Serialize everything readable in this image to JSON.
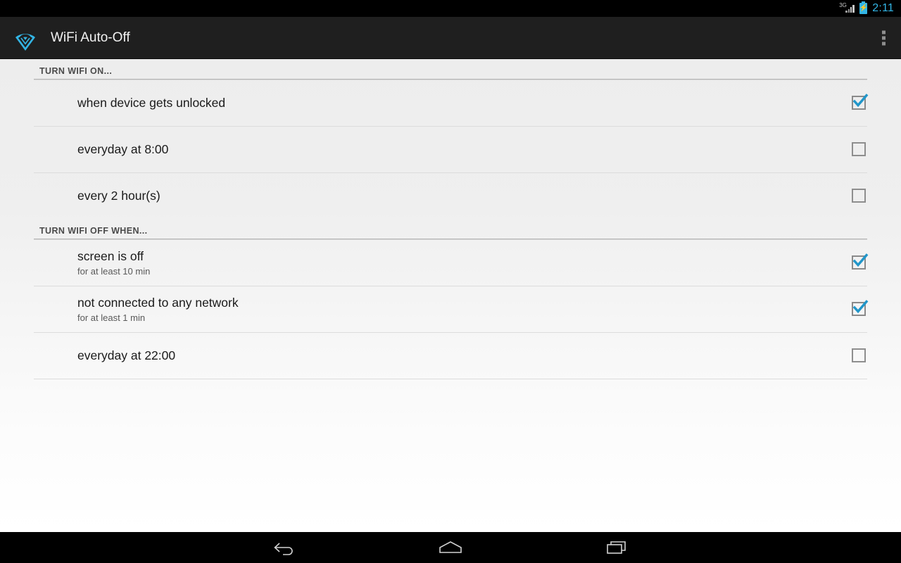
{
  "statusbar": {
    "network_label": "3G",
    "battery_icon": "battery-charging-icon",
    "time": "2:11",
    "accent": "#33b5e5"
  },
  "actionbar": {
    "app_icon": "wifi-icon",
    "title": "WiFi Auto-Off",
    "overflow_label": "More options",
    "overflow_icon": "overflow-menu-icon"
  },
  "sections": [
    {
      "header": "TURN WIFI ON...",
      "rows": [
        {
          "title": "when device gets unlocked",
          "subtitle": "",
          "checked": true
        },
        {
          "title": "everyday at 8:00",
          "subtitle": "",
          "checked": false
        },
        {
          "title": "every 2 hour(s)",
          "subtitle": "",
          "checked": false
        }
      ]
    },
    {
      "header": "TURN WIFI OFF WHEN...",
      "rows": [
        {
          "title": "screen is off",
          "subtitle": "for at least 10 min",
          "checked": true
        },
        {
          "title": "not connected to any network",
          "subtitle": "for at least 1 min",
          "checked": true
        },
        {
          "title": "everyday at 22:00",
          "subtitle": "",
          "checked": false
        }
      ]
    }
  ],
  "navbar": {
    "back_label": "Back",
    "home_label": "Home",
    "recents_label": "Recent apps",
    "back_icon": "back-arrow-icon",
    "home_icon": "home-icon",
    "recents_icon": "recents-icon"
  }
}
